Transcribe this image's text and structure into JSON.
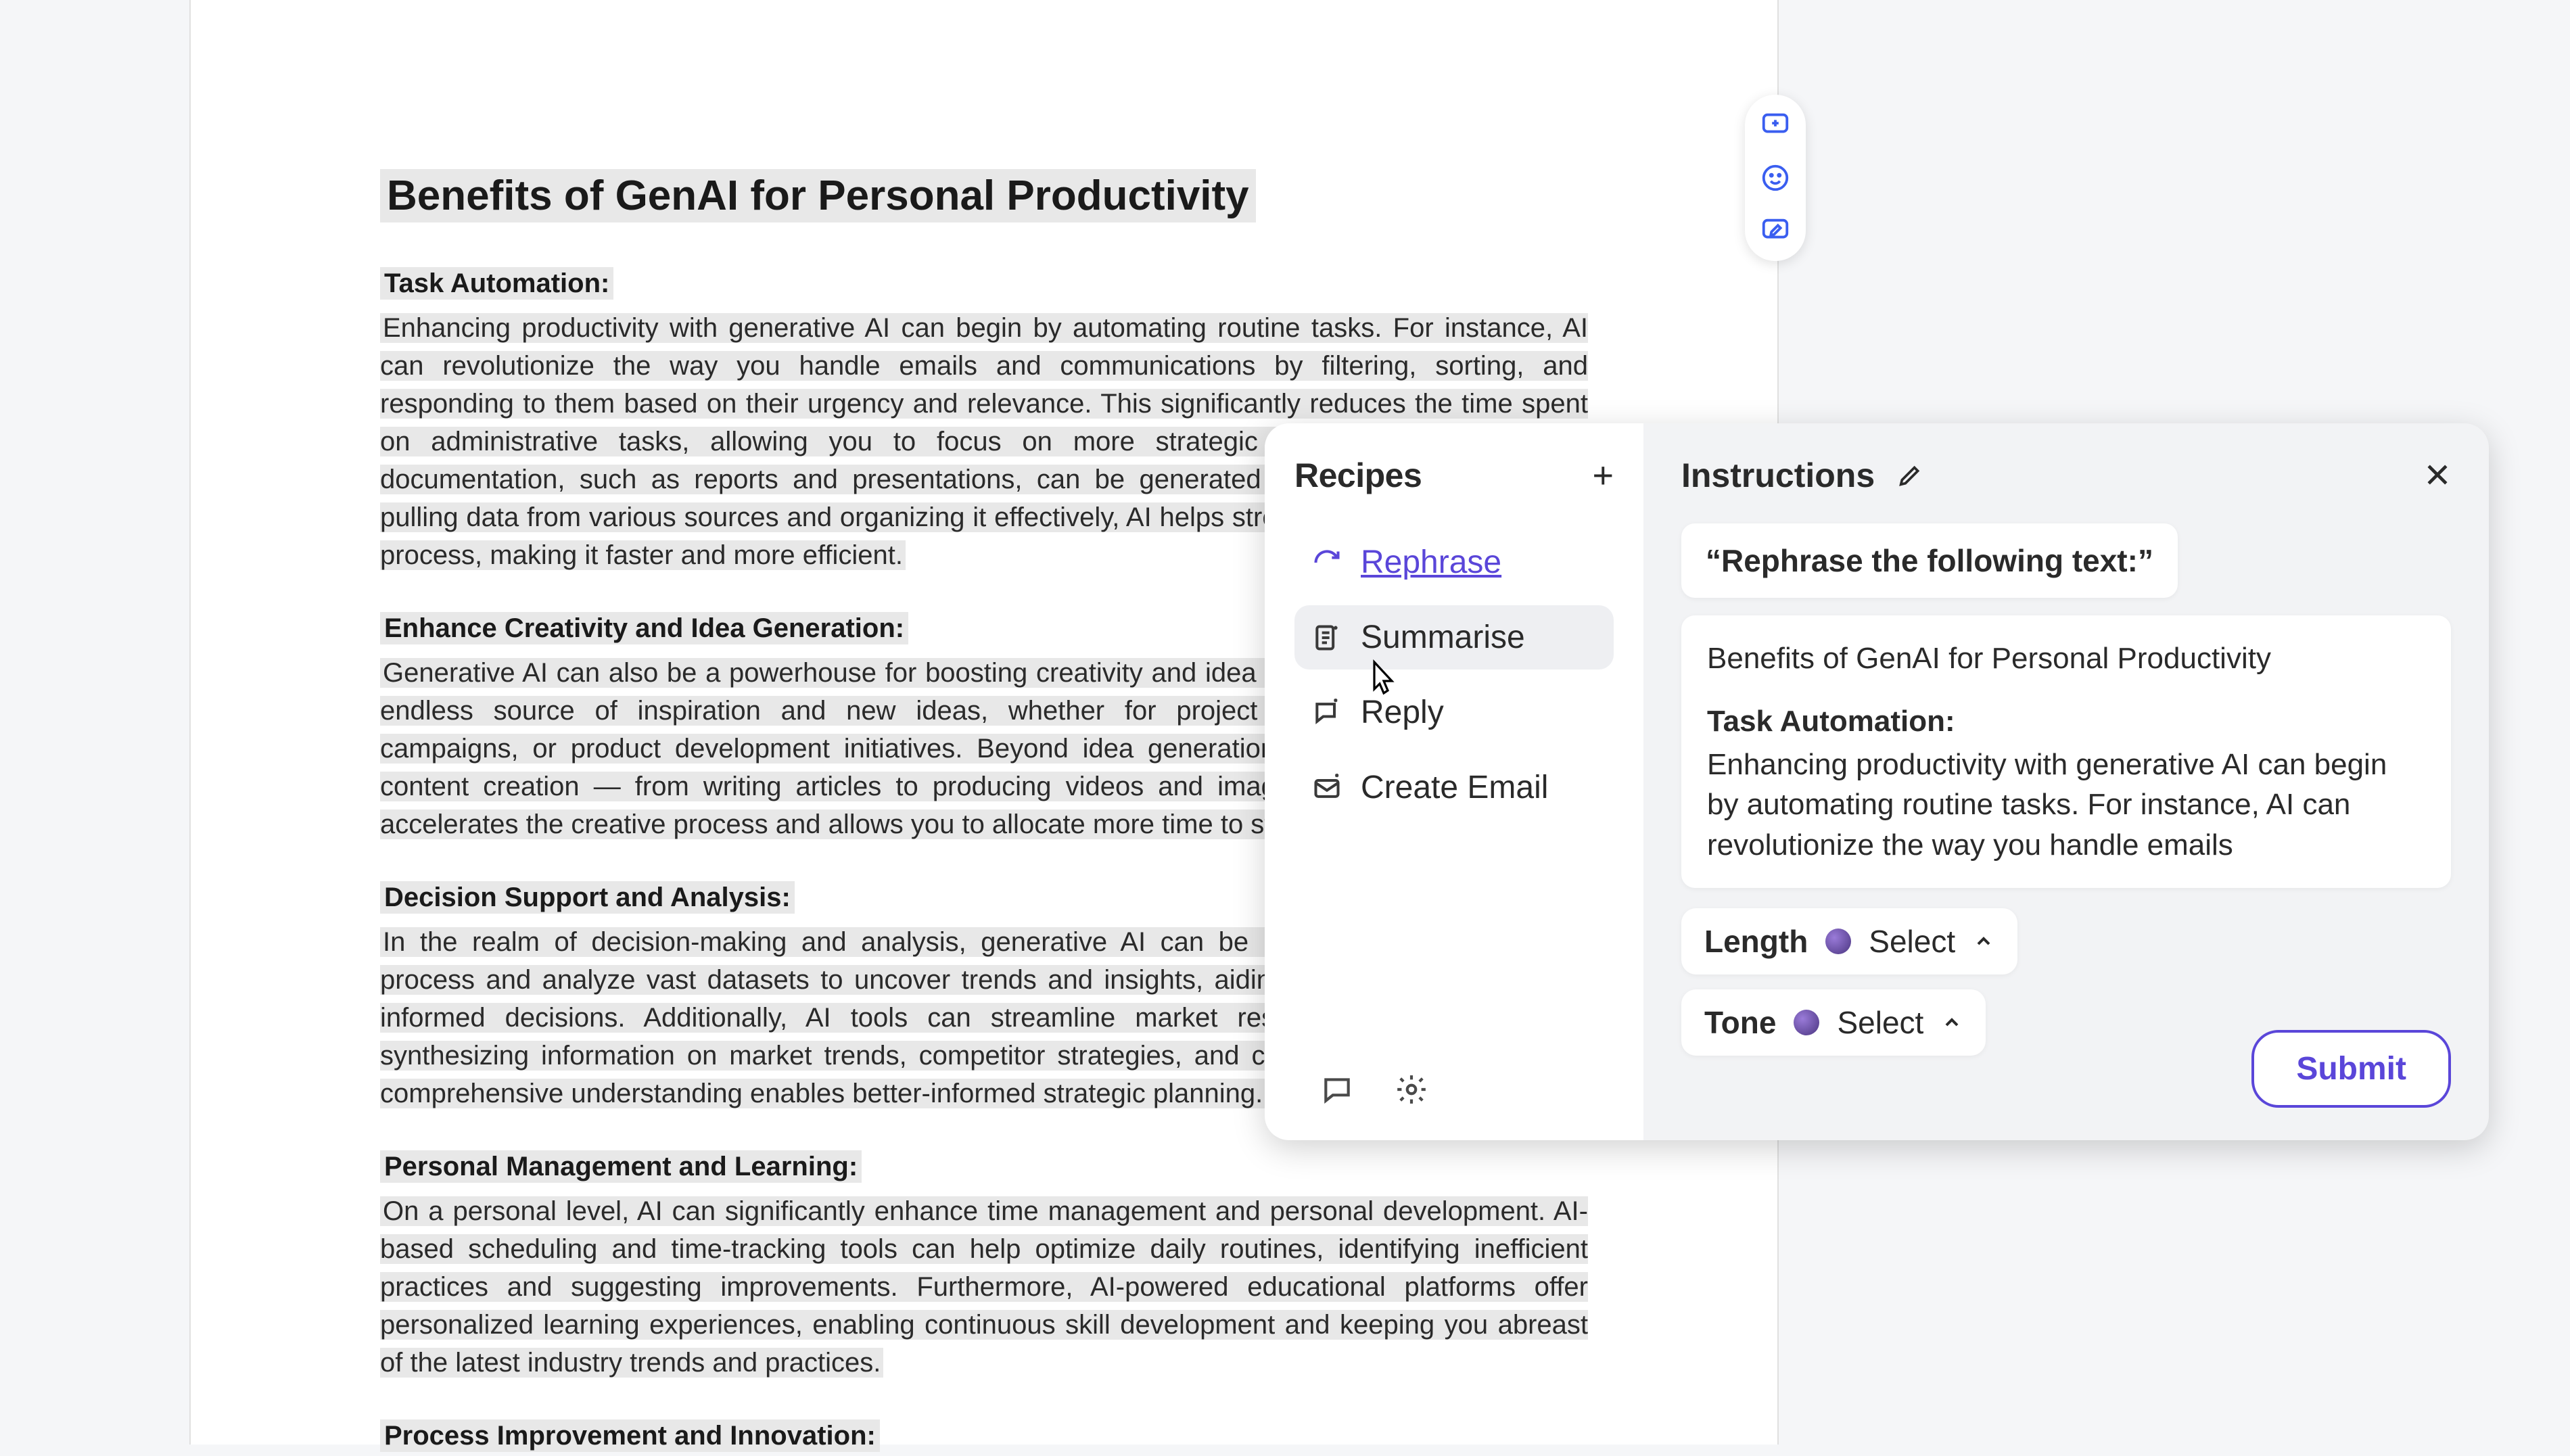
{
  "document": {
    "title": "Benefits of GenAI for Personal Productivity",
    "sections": [
      {
        "heading": "Task Automation:",
        "body": "Enhancing productivity with generative AI can begin by automating routine tasks. For instance, AI can revolutionize the way you handle emails and communications by filtering, sorting, and responding to them based on their urgency and relevance. This significantly reduces the time spent on administrative tasks, allowing you to focus on more strategic work. Moreover, routine documentation, such as reports and presentations, can be generated automatically with AI. By pulling data from various sources and organizing it effectively, AI helps streamline the documentation process, making it faster and more efficient."
      },
      {
        "heading": "Enhance Creativity and Idea Generation:",
        "body": "Generative AI can also be a powerhouse for boosting creativity and idea generation. It serves as an endless source of inspiration and new ideas, whether for project brainstorming, marketing campaigns, or product development initiatives. Beyond idea generation, AI can also assist with content creation — from writing articles to producing videos and images — which dramatically accelerates the creative process and allows you to allocate more time to strategic planning."
      },
      {
        "heading": "Decision Support and Analysis:",
        "body": "In the realm of decision-making and analysis, generative AI can be incredibly valuable. It can process and analyze vast datasets to uncover trends and insights, aiding in data-driven and well-informed decisions. Additionally, AI tools can streamline market research by collecting and synthesizing information on market trends, competitor strategies, and customer preferences. This comprehensive understanding enables better-informed strategic planning."
      },
      {
        "heading": "Personal Management and Learning:",
        "body": "On a personal level, AI can significantly enhance time management and personal development. AI-based scheduling and time-tracking tools can help optimize daily routines, identifying inefficient practices and suggesting improvements. Furthermore, AI-powered educational platforms offer personalized learning experiences, enabling continuous skill development and keeping you abreast of the latest industry trends and practices."
      },
      {
        "heading": "Process Improvement and Innovation:",
        "body": ""
      }
    ]
  },
  "quick_actions": {
    "add_comment": "add-comment",
    "emoji": "emoji",
    "suggest": "suggest-edit"
  },
  "assistant": {
    "recipes_title": "Recipes",
    "instructions_title": "Instructions",
    "recipes": [
      {
        "id": "rephrase",
        "label": "Rephrase",
        "active": true,
        "hovered": false
      },
      {
        "id": "summarise",
        "label": "Summarise",
        "active": false,
        "hovered": true
      },
      {
        "id": "reply",
        "label": "Reply",
        "active": false,
        "hovered": false
      },
      {
        "id": "create-email",
        "label": "Create Email",
        "active": false,
        "hovered": false
      }
    ],
    "prompt": "“Rephrase the following text:”",
    "context": {
      "title": "Benefits of GenAI for Personal Productivity",
      "subheading": "Task Automation:",
      "excerpt": "Enhancing productivity with generative AI can begin by automating routine tasks. For instance, AI can revolutionize the way you handle emails"
    },
    "controls": {
      "length_label": "Length",
      "length_value": "Select",
      "tone_label": "Tone",
      "tone_value": "Select"
    },
    "submit_label": "Submit"
  }
}
